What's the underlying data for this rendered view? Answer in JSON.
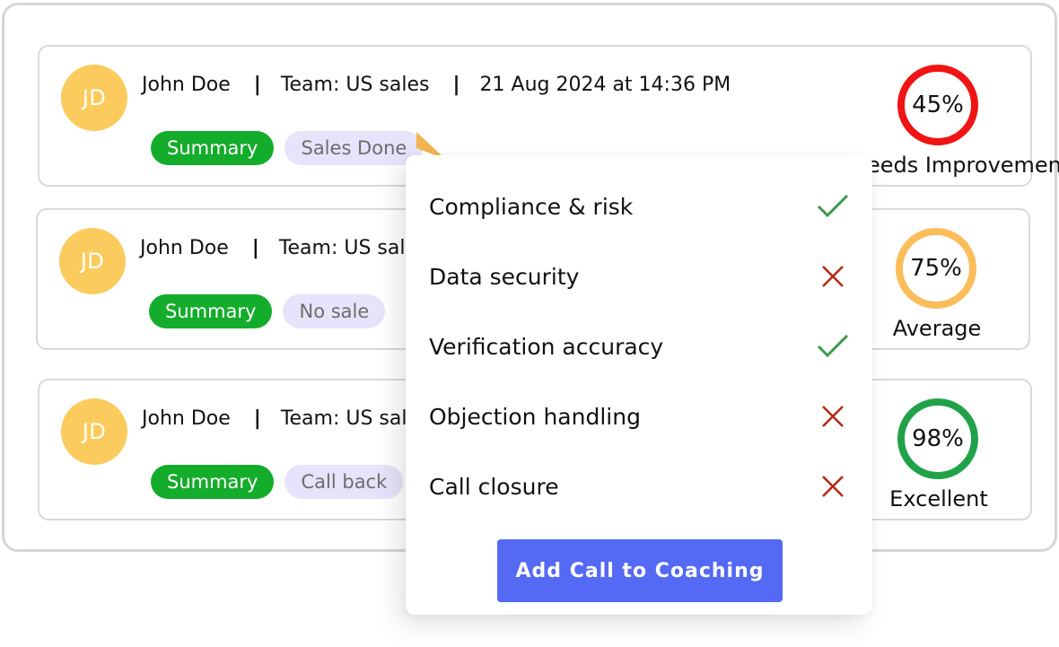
{
  "colors": {
    "avatar": "#fbcb5e",
    "summary_tag": "#14ac2b",
    "status_tag_bg": "#e6e3fa",
    "button": "#5469f4",
    "check_green": "#3d9a4f",
    "cross_red": "#b52a14",
    "cursor": "#f4b34f"
  },
  "calls": [
    {
      "initials": "JD",
      "name": "John Doe",
      "separator": "|",
      "team": "Team: US sales",
      "date": "21 Aug 2024 at 14:36 PM",
      "summary_label": "Summary",
      "status_label": "Sales Done",
      "score_text": "45%",
      "score_value": 45,
      "score_label": "Needs Improvement",
      "score_color": "#f01414"
    },
    {
      "initials": "JD",
      "name": "John Doe",
      "separator": "|",
      "team": "Team: US sales",
      "date": "",
      "summary_label": "Summary",
      "status_label": "No sale",
      "score_text": "75%",
      "score_value": 75,
      "score_label": "Average",
      "score_color": "#fbbd5a"
    },
    {
      "initials": "JD",
      "name": "John Doe",
      "separator": "|",
      "team": "Team: US sales",
      "date": "",
      "summary_label": "Summary",
      "status_label": "Call back",
      "score_text": "98%",
      "score_value": 98,
      "score_label": "Excellent",
      "score_color": "#21a24a"
    }
  ],
  "checklist": {
    "items": [
      {
        "label": "Compliance & risk",
        "passed": true,
        "icon": "check-icon"
      },
      {
        "label": "Data security",
        "passed": false,
        "icon": "cross-icon"
      },
      {
        "label": "Verification accuracy",
        "passed": true,
        "icon": "check-icon"
      },
      {
        "label": "Objection handling",
        "passed": false,
        "icon": "cross-icon"
      },
      {
        "label": "Call closure",
        "passed": false,
        "icon": "cross-icon"
      }
    ],
    "button_label": "Add  Call to Coaching"
  }
}
